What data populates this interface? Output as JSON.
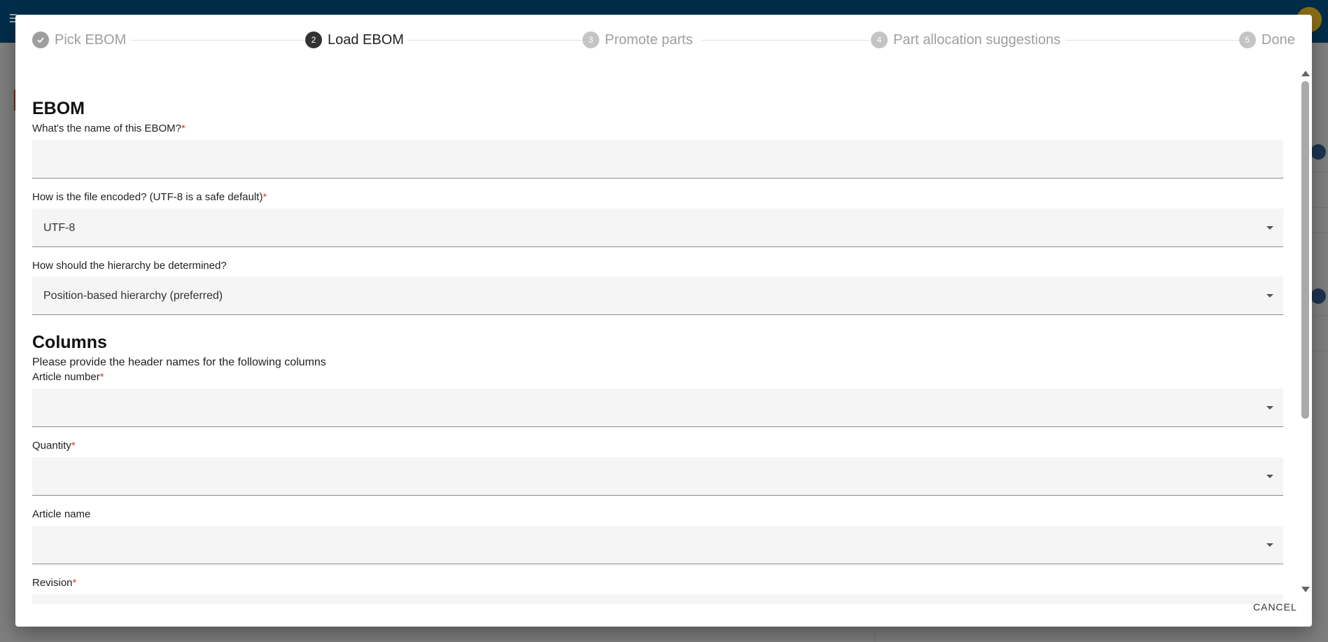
{
  "stepper": {
    "steps": [
      {
        "number": "✓",
        "label": "Pick EBOM",
        "state": "done"
      },
      {
        "number": "2",
        "label": "Load EBOM",
        "state": "active"
      },
      {
        "number": "3",
        "label": "Promote parts",
        "state": "pending"
      },
      {
        "number": "4",
        "label": "Part allocation suggestions",
        "state": "pending"
      },
      {
        "number": "5",
        "label": "Done",
        "state": "pending"
      }
    ]
  },
  "ebom": {
    "heading": "EBOM",
    "name_label": "What's the name of this EBOM?",
    "name_value": "",
    "encoding_label": "How is the file encoded? (UTF-8 is a safe default)",
    "encoding_value": "UTF-8",
    "hierarchy_label": "How should the hierarchy be determined?",
    "hierarchy_value": "Position-based hierarchy (preferred)"
  },
  "columns": {
    "heading": "Columns",
    "help": "Please provide the header names for the following columns",
    "article_number_label": "Article number",
    "quantity_label": "Quantity",
    "article_name_label": "Article name",
    "revision_label": "Revision"
  },
  "required_marker": "*",
  "actions": {
    "cancel": "CANCEL"
  },
  "colors": {
    "topbar": "#022d4a",
    "required": "#e53935"
  }
}
